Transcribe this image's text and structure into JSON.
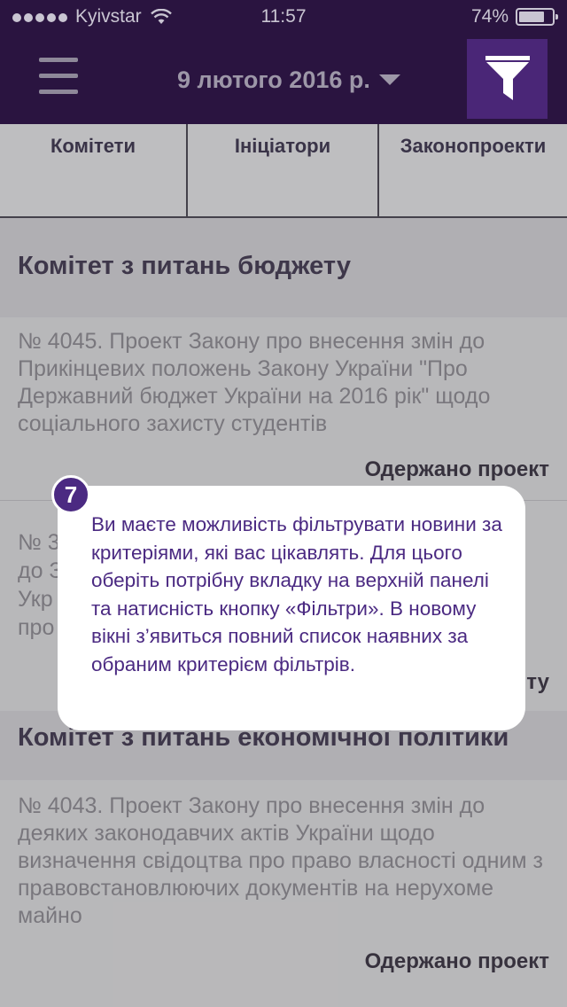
{
  "status_bar": {
    "carrier": "Kyivstar",
    "time": "11:57",
    "battery_percent": "74%"
  },
  "header": {
    "date": "9 лютого 2016 р."
  },
  "tabs": [
    {
      "label": "Комітети"
    },
    {
      "label": "Ініціатори"
    },
    {
      "label": "Законопроекти"
    }
  ],
  "sections": [
    {
      "title": "Комітет з питань бюджету",
      "items": [
        {
          "text": "№ 4045. Проект Закону про внесення змін до Прикінцевих положень Закону України \"Про Державний бюджет України на 2016 рік\" щодо соціального захисту студентів",
          "status": "Одержано проект"
        },
        {
          "text": "№ 3",
          "text_line2": "до З",
          "text_line3": "Укр",
          "text_line4": "про",
          "status": "ту"
        }
      ]
    },
    {
      "title": "Комітет з питань економічної політики",
      "items": [
        {
          "text": "№ 4043. Проект Закону про внесення змін до деяких законодавчих актів України щодо визначення свідоцтва про право власності одним з правовстановлюючих документів на нерухоме майно",
          "status": "Одержано проект"
        }
      ]
    }
  ],
  "tooltip": {
    "step": "7",
    "text": "Ви маєте можливість фільтрувати новини за критеріями, які вас цікавлять. Для цього оберіть потрібну вкладку на верхній панелі та натисність кнопку «Фільтри». В новому вікні з’явиться повний список наявних за обраним критерієм фільтрів."
  }
}
